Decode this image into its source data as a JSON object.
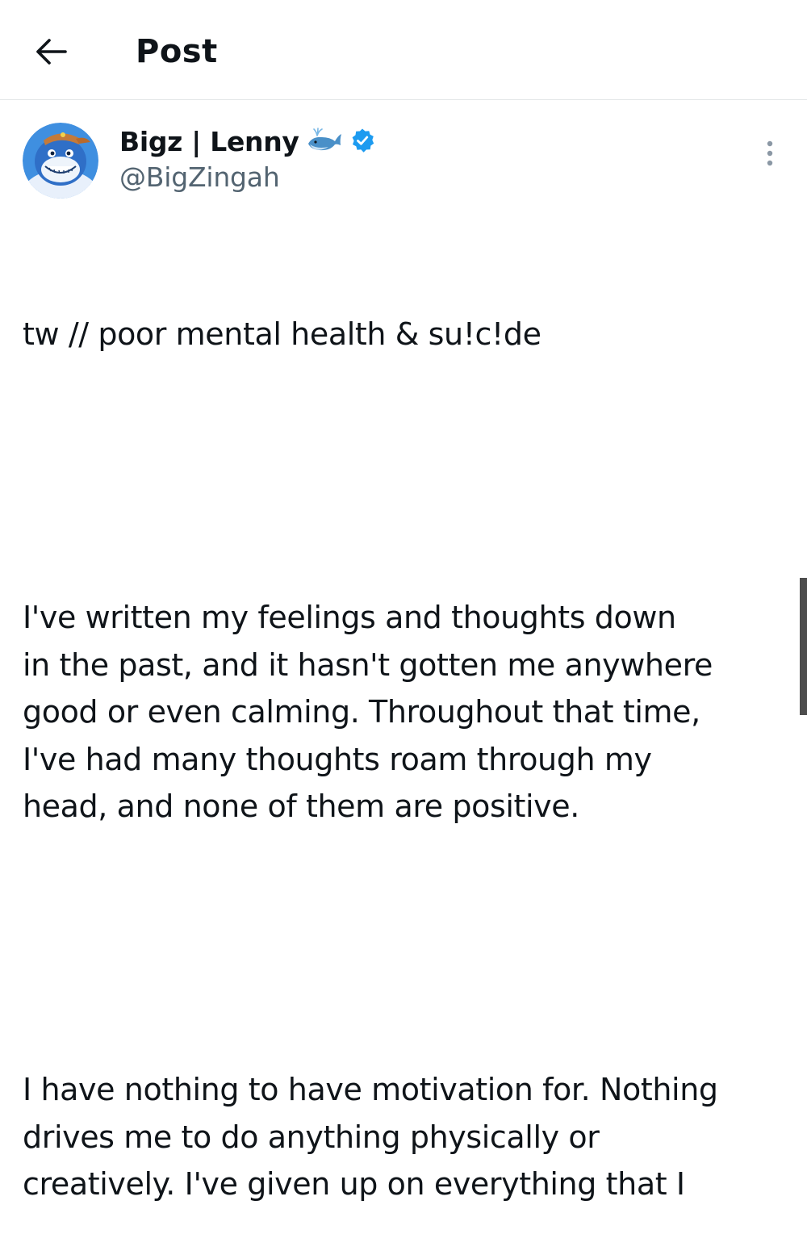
{
  "header": {
    "title": "Post",
    "back_icon": "arrow-left-icon"
  },
  "author": {
    "display_name": "Bigz | Lenny",
    "emoji": "🐋",
    "verified_icon": "verified-badge-icon",
    "verified_color": "#1d9bf0",
    "handle": "@BigZingah",
    "avatar_icon": "shark-avatar-icon"
  },
  "post": {
    "paragraphs": [
      "tw // poor mental health & su!c!de",
      "I've written my feelings and thoughts down\nin the past, and it hasn't gotten me anywhere\ngood or even calming. Throughout that time,\nI've had many thoughts roam through my\nhead, and none of them are positive.",
      "I have nothing to have motivation for. Nothing\ndrives me to do anything physically or\ncreatively. I've given up on everything that I"
    ]
  },
  "colors": {
    "text_primary": "#0f1419",
    "text_secondary": "#536471",
    "divider": "#e3e6e8",
    "scrollbar": "#4d4d4d"
  },
  "more_icon": "more-vertical-icon"
}
